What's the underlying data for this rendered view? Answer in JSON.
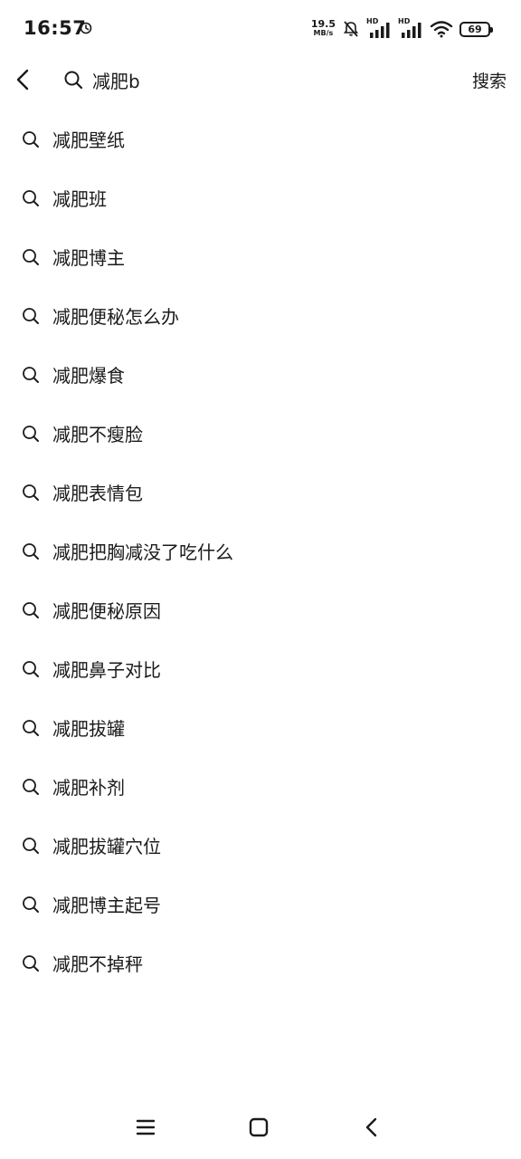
{
  "status_bar": {
    "time": "16:57",
    "net_speed_value": "19.5",
    "net_speed_unit": "MB/s",
    "sim1_label": "HD",
    "sim2_label": "HD",
    "battery_level": "69"
  },
  "search": {
    "query": "减肥b",
    "submit_label": "搜索"
  },
  "suggestions": [
    "减肥壁纸",
    "减肥班",
    "减肥博主",
    "减肥便秘怎么办",
    "减肥爆食",
    "减肥不瘦脸",
    "减肥表情包",
    "减肥把胸减没了吃什么",
    "减肥便秘原因",
    "减肥鼻子对比",
    "减肥拔罐",
    "减肥补剂",
    "减肥拔罐穴位",
    "减肥博主起号",
    "减肥不掉秤"
  ],
  "icons": {
    "back": "chevron-left-icon",
    "search": "search-icon",
    "nav_menu": "menu-icon",
    "nav_home": "square-home-icon",
    "nav_back": "back-triangle-icon"
  }
}
